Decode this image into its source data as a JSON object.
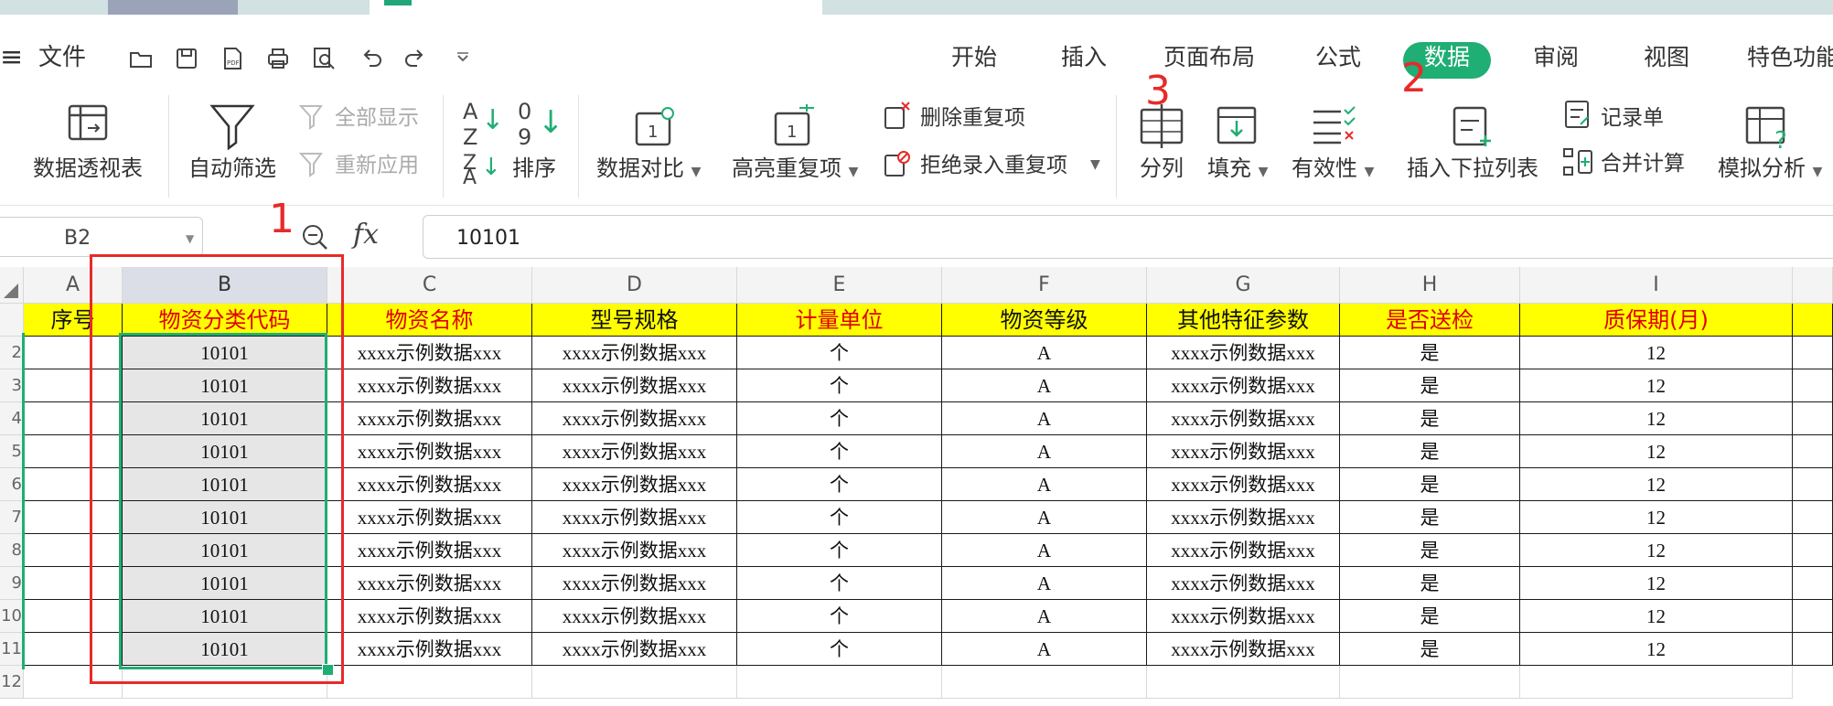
{
  "menu": {
    "hamburger": "≡",
    "file": "文件",
    "tabs": [
      "开始",
      "插入",
      "页面布局",
      "公式",
      "数据",
      "审阅",
      "视图",
      "特色功能"
    ],
    "active_tab": "数据"
  },
  "ribbon": {
    "pivot": "数据透视表",
    "autofilter": "自动筛选",
    "show_all": "全部显示",
    "reapply": "重新应用",
    "sort": "排序",
    "compare": "数据对比",
    "highlight_dup": "高亮重复项",
    "remove_dup": "删除重复项",
    "reject_dup": "拒绝录入重复项",
    "split": "分列",
    "fill": "填充",
    "validity": "有效性",
    "insert_dropdown": "插入下拉列表",
    "record_form": "记录单",
    "consolidate": "合并计算",
    "what_if": "模拟分析",
    "sort_az_top": "A",
    "sort_az_bottom": "Z",
    "sort_num_top": "0",
    "sort_num_bottom": "9",
    "compare_glyph": "1",
    "highlight_glyph": "1"
  },
  "formula_bar": {
    "name_box": "B2",
    "fx": "fx",
    "value": "10101"
  },
  "sheet": {
    "columns": [
      "A",
      "B",
      "C",
      "D",
      "E",
      "F",
      "G",
      "H",
      "I"
    ],
    "row_numbers": [
      "2",
      "3",
      "4",
      "5",
      "6",
      "7",
      "8",
      "9",
      "10",
      "11",
      "12"
    ],
    "headers": [
      "序号",
      "物资分类代码",
      "物资名称",
      "型号规格",
      "计量单位",
      "物资等级",
      "其他特征参数",
      "是否送检",
      "质保期(月)"
    ],
    "rows": [
      [
        "",
        "10101",
        "xxxx示例数据xxx",
        "xxxx示例数据xxx",
        "个",
        "A",
        "xxxx示例数据xxx",
        "是",
        "12"
      ],
      [
        "",
        "10101",
        "xxxx示例数据xxx",
        "xxxx示例数据xxx",
        "个",
        "A",
        "xxxx示例数据xxx",
        "是",
        "12"
      ],
      [
        "",
        "10101",
        "xxxx示例数据xxx",
        "xxxx示例数据xxx",
        "个",
        "A",
        "xxxx示例数据xxx",
        "是",
        "12"
      ],
      [
        "",
        "10101",
        "xxxx示例数据xxx",
        "xxxx示例数据xxx",
        "个",
        "A",
        "xxxx示例数据xxx",
        "是",
        "12"
      ],
      [
        "",
        "10101",
        "xxxx示例数据xxx",
        "xxxx示例数据xxx",
        "个",
        "A",
        "xxxx示例数据xxx",
        "是",
        "12"
      ],
      [
        "",
        "10101",
        "xxxx示例数据xxx",
        "xxxx示例数据xxx",
        "个",
        "A",
        "xxxx示例数据xxx",
        "是",
        "12"
      ],
      [
        "",
        "10101",
        "xxxx示例数据xxx",
        "xxxx示例数据xxx",
        "个",
        "A",
        "xxxx示例数据xxx",
        "是",
        "12"
      ],
      [
        "",
        "10101",
        "xxxx示例数据xxx",
        "xxxx示例数据xxx",
        "个",
        "A",
        "xxxx示例数据xxx",
        "是",
        "12"
      ],
      [
        "",
        "10101",
        "xxxx示例数据xxx",
        "xxxx示例数据xxx",
        "个",
        "A",
        "xxxx示例数据xxx",
        "是",
        "12"
      ],
      [
        "",
        "10101",
        "xxxx示例数据xxx",
        "xxxx示例数据xxx",
        "个",
        "A",
        "xxxx示例数据xxx",
        "是",
        "12"
      ]
    ],
    "red_header_columns": [
      "B",
      "C",
      "E",
      "H",
      "I"
    ]
  },
  "annotations": {
    "step1": "1",
    "step2": "2",
    "step3": "3"
  },
  "colors": {
    "accent": "#1fae73",
    "annotation": "#e82a2a",
    "header_fill": "#ffff00"
  }
}
